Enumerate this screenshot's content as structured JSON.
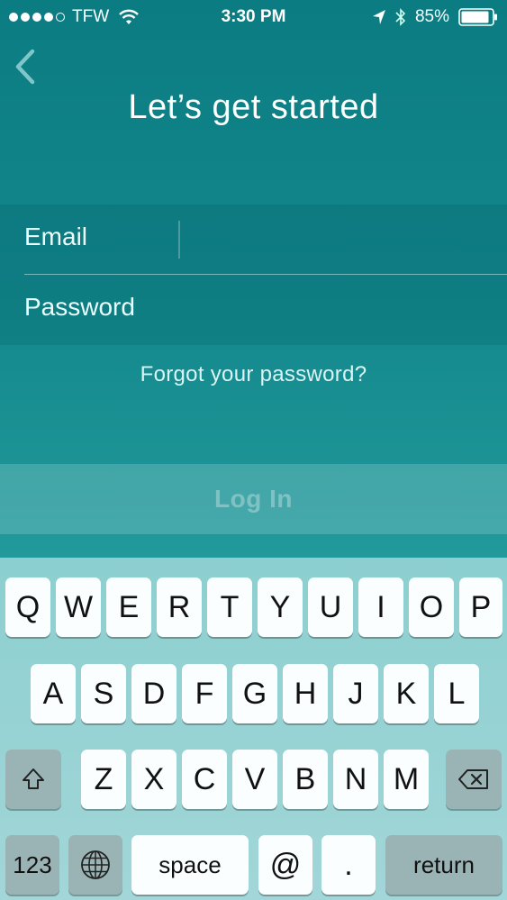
{
  "status_bar": {
    "carrier": "TFW",
    "time": "3:30 PM",
    "battery": "85%"
  },
  "header": {
    "title": "Let’s get started"
  },
  "form": {
    "email_label": "Email",
    "email_value": "",
    "password_label": "Password",
    "password_value": ""
  },
  "forgot_link": "Forgot your password?",
  "login_button": "Log In",
  "keyboard": {
    "row1": [
      "Q",
      "W",
      "E",
      "R",
      "T",
      "Y",
      "U",
      "I",
      "O",
      "P"
    ],
    "row2": [
      "A",
      "S",
      "D",
      "F",
      "G",
      "H",
      "J",
      "K",
      "L"
    ],
    "row3": [
      "Z",
      "X",
      "C",
      "V",
      "B",
      "N",
      "M"
    ],
    "numbers_key": "123",
    "space_key": "space",
    "at_key": "@",
    "dot_key": ".",
    "return_key": "return"
  },
  "colors": {
    "background_top": "#0b7c82",
    "background_bottom": "#2aa3a4",
    "keyboard_bg": "#a2d6d8"
  }
}
